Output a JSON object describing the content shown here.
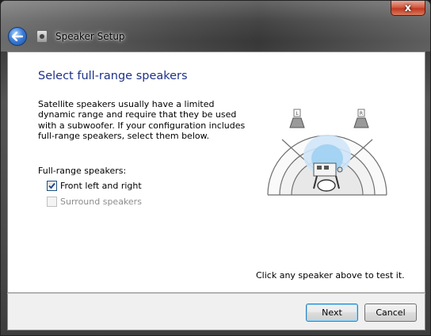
{
  "window": {
    "title": "Speaker Setup",
    "close_glyph": "x"
  },
  "main": {
    "heading": "Select full-range speakers",
    "description": "Satellite speakers usually have a limited dynamic range and require that they be used with a subwoofer.  If your configuration includes full-range speakers, select them below.",
    "group_label": "Full-range speakers:",
    "options": [
      {
        "label": "Front left and right",
        "checked": true,
        "enabled": true
      },
      {
        "label": "Surround speakers",
        "checked": false,
        "enabled": false
      }
    ],
    "test_hint": "Click any speaker above to test it.",
    "speakers": {
      "left_label": "L",
      "right_label": "R"
    }
  },
  "footer": {
    "next_label": "Next",
    "cancel_label": "Cancel"
  },
  "colors": {
    "heading": "#1e3287",
    "accent": "#3c7fb1"
  },
  "icons": [
    "back-arrow-icon",
    "speaker-setup-icon",
    "checkmark-icon",
    "speaker-icon",
    "listener-icon"
  ]
}
